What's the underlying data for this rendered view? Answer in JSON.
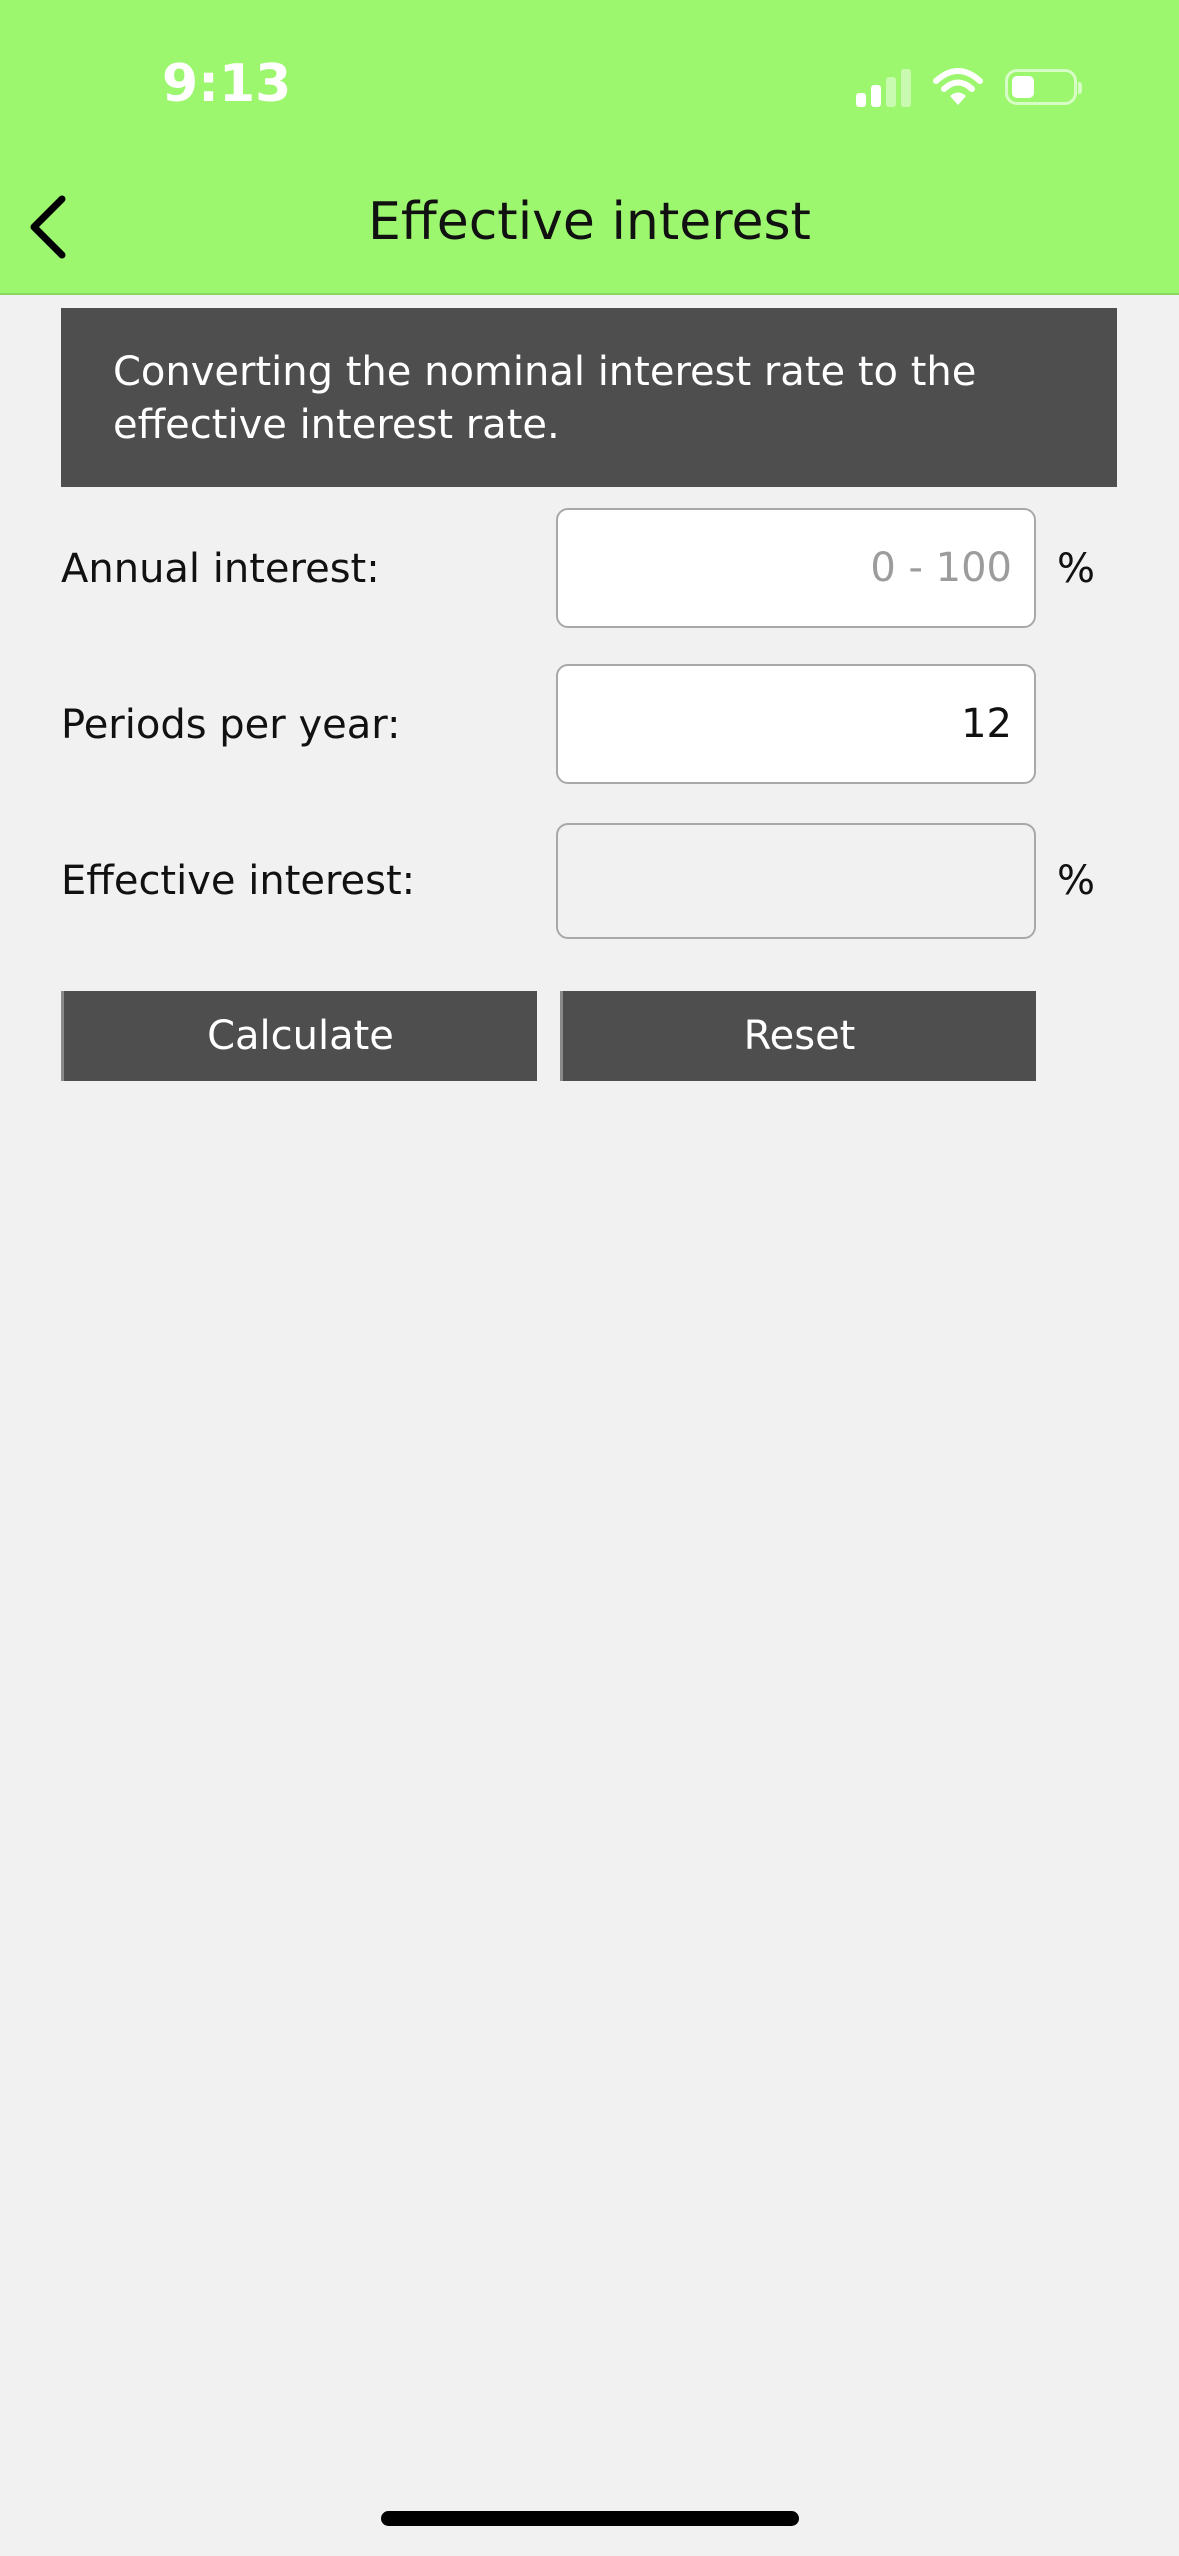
{
  "status_bar": {
    "time": "9:13"
  },
  "header": {
    "title": "Effective interest",
    "back_icon": "chevron-left-icon",
    "background": "#9cf76e"
  },
  "description": "Converting the nominal interest rate to the effective interest rate.",
  "form": {
    "annual_interest": {
      "label": "Annual interest:",
      "value": "",
      "placeholder": "0 - 100",
      "unit": "%"
    },
    "periods_per_year": {
      "label": "Periods per year:",
      "value": "12"
    },
    "effective_interest": {
      "label": "Effective interest:",
      "value": "",
      "unit": "%"
    }
  },
  "buttons": {
    "calculate": "Calculate",
    "reset": "Reset"
  }
}
